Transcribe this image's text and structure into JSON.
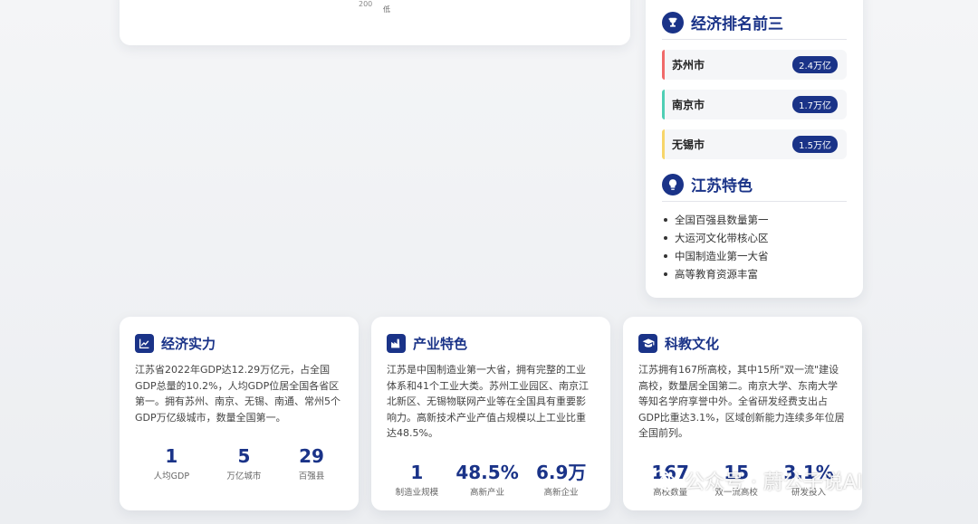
{
  "map_legend": {
    "value": "200",
    "low_label": "低"
  },
  "ranking": {
    "title": "经济排名前三",
    "items": [
      {
        "city": "苏州市",
        "gdp": "2.4万亿",
        "color": "#f06a6a"
      },
      {
        "city": "南京市",
        "gdp": "1.7万亿",
        "color": "#4fcfb5"
      },
      {
        "city": "无锡市",
        "gdp": "1.5万亿",
        "color": "#f7d56a"
      }
    ]
  },
  "features": {
    "title": "江苏特色",
    "items": [
      "全国百强县数量第一",
      "大运河文化带核心区",
      "中国制造业第一大省",
      "高等教育资源丰富"
    ]
  },
  "economy": {
    "title": "经济实力",
    "desc": "江苏省2022年GDP达12.29万亿元，占全国GDP总量的10.2%，人均GDP位居全国各省区第一。拥有苏州、南京、无锡、南通、常州5个GDP万亿级城市，数量全国第一。",
    "stats": [
      {
        "num": "1",
        "label": "人均GDP"
      },
      {
        "num": "5",
        "label": "万亿城市"
      },
      {
        "num": "29",
        "label": "百强县"
      }
    ]
  },
  "industry": {
    "title": "产业特色",
    "desc": "江苏是中国制造业第一大省，拥有完整的工业体系和41个工业大类。苏州工业园区、南京江北新区、无锡物联网产业等在全国具有重要影响力。高新技术产业产值占规模以上工业比重达48.5%。",
    "stats": [
      {
        "num": "1",
        "label": "制造业规模"
      },
      {
        "num": "48.5%",
        "label": "高新产业"
      },
      {
        "num": "6.9万",
        "label": "高新企业"
      }
    ]
  },
  "education": {
    "title": "科教文化",
    "desc": "江苏拥有167所高校，其中15所\"双一流\"建设高校，数量居全国第二。南京大学、东南大学等知名学府享誉中外。全省研发经费支出占GDP比重达3.1%，区域创新能力连续多年位居全国前列。",
    "stats": [
      {
        "num": "167",
        "label": "高校数量"
      },
      {
        "num": "15",
        "label": "双一流高校"
      },
      {
        "num": "3.1%",
        "label": "研发投入"
      }
    ]
  },
  "watermark": {
    "text": "公众号 · 蔚公子说AI"
  },
  "colors": {
    "brand": "#1a3388"
  }
}
